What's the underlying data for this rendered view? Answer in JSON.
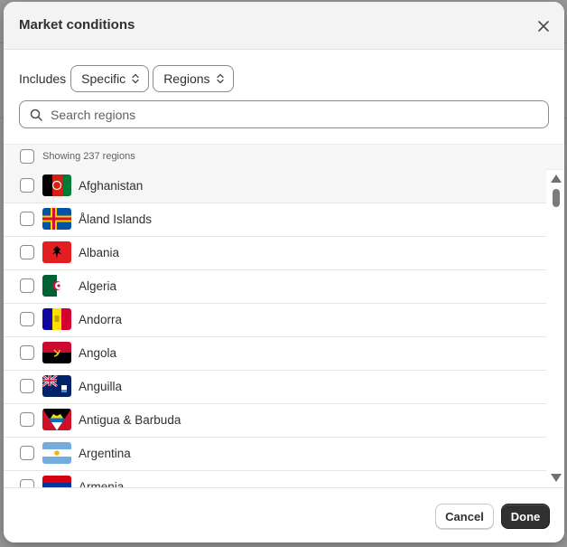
{
  "modal": {
    "title": "Market conditions",
    "close_icon": "close-icon"
  },
  "filters": {
    "includes_label": "Includes",
    "mode_value": "Specific",
    "scope_value": "Regions"
  },
  "search": {
    "placeholder": "Search regions",
    "icon": "search-icon"
  },
  "list": {
    "count_label": "Showing 237 regions",
    "items": [
      {
        "label": "Afghanistan",
        "flag": "flag-af"
      },
      {
        "label": "Åland Islands",
        "flag": "flag-ax"
      },
      {
        "label": "Albania",
        "flag": "flag-al"
      },
      {
        "label": "Algeria",
        "flag": "flag-dz"
      },
      {
        "label": "Andorra",
        "flag": "flag-ad"
      },
      {
        "label": "Angola",
        "flag": "flag-ao"
      },
      {
        "label": "Anguilla",
        "flag": "flag-ai"
      },
      {
        "label": "Antigua & Barbuda",
        "flag": "flag-ag"
      },
      {
        "label": "Argentina",
        "flag": "flag-ar"
      },
      {
        "label": "Armenia",
        "flag": "flag-am"
      }
    ]
  },
  "footer": {
    "cancel_label": "Cancel",
    "done_label": "Done"
  },
  "colors": {
    "primary_button": "#303030",
    "border": "#8a8a8a",
    "text": "#303030",
    "muted_text": "#616161"
  }
}
